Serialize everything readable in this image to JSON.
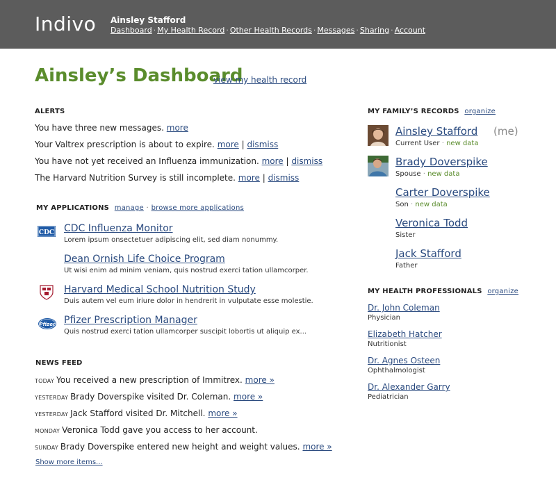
{
  "header": {
    "logo": "Indivo",
    "user_name": "Ainsley Stafford",
    "nav": [
      "Dashboard",
      "My Health Record",
      "Other Health Records",
      "Messages",
      "Sharing",
      "Account"
    ],
    "bg_color": "#5c5c5c"
  },
  "page": {
    "title": "Ainsley’s Dashboard",
    "title_link": "view my health record",
    "accent_color": "#5a8c2c"
  },
  "alerts": {
    "heading": "ALERTS",
    "items": [
      {
        "text": "You have three new messages.",
        "more": "more"
      },
      {
        "text": "Your Valtrex prescription is about to expire.",
        "more": "more",
        "sep": "|",
        "dismiss": "dismiss"
      },
      {
        "text": "You have not yet received an Influenza immunization.",
        "more": "more",
        "sep": "|",
        "dismiss": "dismiss"
      },
      {
        "text": "The Harvard Nutrition Survey is still incomplete.",
        "more": "more",
        "sep": "|",
        "dismiss": "dismiss"
      }
    ]
  },
  "applications": {
    "heading": "MY APPLICATIONS",
    "manage": "manage",
    "sep": "·",
    "browse": "browse more applications",
    "items": [
      {
        "name": "CDC Influenza Monitor",
        "desc": "Lorem ipsum onsectetuer adipiscing elit, sed diam nonummy.",
        "icon": "cdc-logo-icon",
        "icon_text": "CDC"
      },
      {
        "name": "Dean Ornish Life Choice Program",
        "desc": "Ut wisi enim ad minim veniam, quis nostrud exerci tation ullamcorper.",
        "icon": "",
        "icon_text": ""
      },
      {
        "name": "Harvard Medical School Nutrition Study",
        "desc": "Duis autem vel eum iriure dolor in hendrerit in vulputate esse molestie.",
        "icon": "harvard-shield-icon",
        "icon_text": ""
      },
      {
        "name": "Pfizer Prescription Manager",
        "desc": "Quis nostrud exerci tation ullamcorper suscipit lobortis ut aliquip ex...",
        "icon": "pfizer-logo-icon",
        "icon_text": "Pfizer"
      }
    ]
  },
  "news": {
    "heading": "NEWS FEED",
    "items": [
      {
        "when": "TODAY",
        "text": "You received a new prescription of Immitrex.",
        "more": "more »"
      },
      {
        "when": "YESTERDAY",
        "text": "Brady Doverspike visited Dr. Coleman.",
        "more": "more »"
      },
      {
        "when": "YESTERDAY",
        "text": "Jack Stafford visited Dr. Mitchell.",
        "more": "more »"
      },
      {
        "when": "MONDAY",
        "text": "Veronica Todd gave you access to her account.",
        "more": ""
      },
      {
        "when": "SUNDAY",
        "text": "Brady Doverspike entered new height and weight values.",
        "more": "more »"
      }
    ],
    "show_more": "Show more items..."
  },
  "family": {
    "heading": "MY FAMILY’S RECORDS",
    "organize": "organize",
    "members": [
      {
        "name": "Ainsley Stafford",
        "me": "(me)",
        "relation": "Current User",
        "dot": "·",
        "new_data": "new data",
        "photo": "woman-photo-icon"
      },
      {
        "name": "Brady Doverspike",
        "me": "",
        "relation": "Spouse",
        "dot": "·",
        "new_data": "new data",
        "photo": "man-photo-icon"
      },
      {
        "name": "Carter Doverspike",
        "me": "",
        "relation": "Son",
        "dot": "·",
        "new_data": "new data",
        "photo": ""
      },
      {
        "name": "Veronica Todd",
        "me": "",
        "relation": "Sister",
        "dot": "",
        "new_data": "",
        "photo": ""
      },
      {
        "name": "Jack Stafford",
        "me": "",
        "relation": "Father",
        "dot": "",
        "new_data": "",
        "photo": ""
      }
    ]
  },
  "professionals": {
    "heading": "MY HEALTH PROFESSIONALS",
    "organize": "organize",
    "items": [
      {
        "name": "Dr. John Coleman",
        "role": "Physician"
      },
      {
        "name": "Elizabeth Hatcher",
        "role": "Nutritionist"
      },
      {
        "name": "Dr. Agnes Osteen",
        "role": "Ophthalmologist"
      },
      {
        "name": "Dr. Alexander Garry",
        "role": "Pediatrician"
      }
    ]
  }
}
